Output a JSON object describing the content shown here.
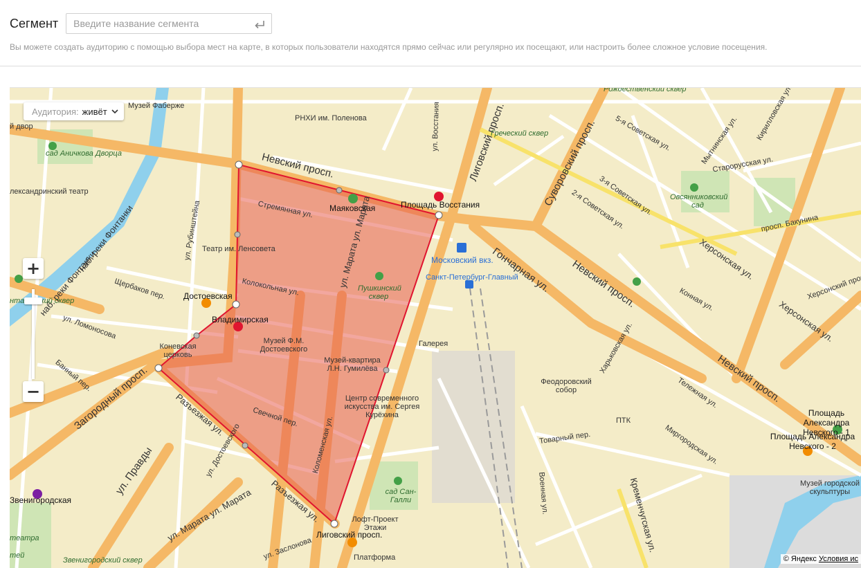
{
  "segment": {
    "label": "Сегмент",
    "placeholder": "Введите название сегмента",
    "hint": "Вы можете создать аудиторию с помощью выбора мест на карте, в которых пользователи находятся прямо сейчас или регулярно их посещают, или настроить более сложное условие посещения."
  },
  "map": {
    "audience_key": "Аудитория:",
    "audience_value": "живёт",
    "zoom_in": "+",
    "zoom_out": "−",
    "copyright": "© Яндекс",
    "terms": "Условия ис",
    "polygon_color": "#e0152f",
    "labels": {
      "nevsky1": "Невский просп.",
      "nevsky2": "Невский просп.",
      "nevsky3": "Невский просп.",
      "ligovsky": "Лиговский просп.",
      "suvorovsky": "Суворовский просп.",
      "goncharnaya": "Гончарная ул.",
      "zagorodny": "Загородный просп.",
      "razezzhaya1": "Разъезжая ул.",
      "razezzhaya2": "Разъезжая ул.",
      "pravdy": "ул. Правды",
      "marata1": "ул. Марата",
      "marata2": "ул. Марата",
      "marata3": "ул. Марата ул. Марата",
      "fontanka1": "наб. реки Фонтанки",
      "fontanka2": "наб. реки Фонтанки",
      "stremyannaya": "Стремянная ул.",
      "kolokolnaya": "Колокольная ул.",
      "svechnoy": "Свечной пер.",
      "kolomenskaya": "Коломенская ул.",
      "dostoevskogo": "ул. Достоевского",
      "shcherbakov": "Щербаков пер.",
      "lomonosova": "ул. Ломоносова",
      "banny": "Банный пер.",
      "rubinshteina": "ул. Рубинштейна",
      "vosstaniya": "ул. Восстания",
      "sovetskaya5": "5-я Советская ул.",
      "sovetskaya3": "3-я Советская ул.",
      "sovetskaya2": "2-я Советская ул.",
      "khersonskaya": "Херсонская ул.",
      "mytninskaya": "Мытнинская ул.",
      "kirillovskaya": "Кирилловская ул.",
      "staroruskaya": "Старорусская ул.",
      "bakunina": "просп. Бакунина",
      "konnaya": "Конная ул.",
      "kharkovskaya": "Харьковская ул.",
      "telezhnaya": "Тележная ул.",
      "mirgorodskaya": "Миргородская ул.",
      "tovarny": "Товарный пер.",
      "vokzalnaya": "Военная ул.",
      "kremenchugskaya": "Кременчугская ул.",
      "zaslonova": "ул. Заслонова",
      "grechesky": "Греческий сквер",
      "rozhdestvensky": "Рождественский сквер",
      "khersonsky_right": "Херсонский проезд",
      "ligovsky_small": "Лиговский просп.",
      "marata_bottom": "ул. Марата ул. Марата",
      "ligovsky_v": "Лиговский просп.",
      "khersonskaya2": "Херсонская ул."
    },
    "pois": {
      "faberge": "Музей Фаберже",
      "rnkhi": "РНХИ им. Поленова",
      "anichkov": "сад Аничкова Дворца",
      "alexandrinsky": "лександринский театр",
      "dvor": "й двор",
      "lensoveta": "Театр им. Ленсовета",
      "dostoevskaya": "Достоевская",
      "vladimirskaya": "Владимирская",
      "konevskaya": "Коневская церковь",
      "museum_dost": "Музей Ф.М. Достоевского",
      "mayakovskaya": "Маяковская",
      "pushkinsky": "Пушкинский сквер",
      "gumilev": "Музей-квартира Л.Н. Гумилёва",
      "kurekhin": "Центр современного искусства им. Сергея Курёхина",
      "vosstaniya_sq": "Площадь Восстания",
      "moskovsky": "Московский вкз.",
      "spb_glavny": "Санкт-Петербург-Главный",
      "galereya": "Галерея",
      "ovsyannikovsky": "Овсянниковский сад",
      "feodorovsky": "Феодоровский собор",
      "ptk": "ПТК",
      "alex_nevsky1": "Площадь Александра Невского - 1",
      "alex_nevsky2": "Площадь Александра Невского - 2",
      "sculpture": "Музей городской скульптуры",
      "zvenigorodskaya": "Звенигородская",
      "san_galli": "сад Сан-Галли",
      "etazhi": "Лофт-Проект Этажи",
      "ligovsky_metro": "Лиговский просп.",
      "platforma": "Платформа",
      "zvenigorodsky_sq": "Звенигородский сквер",
      "teatra": "театра",
      "tsvetov": "тей",
      "kaya": "ая",
      "fontanka_sq": "нтановский сквер"
    }
  }
}
